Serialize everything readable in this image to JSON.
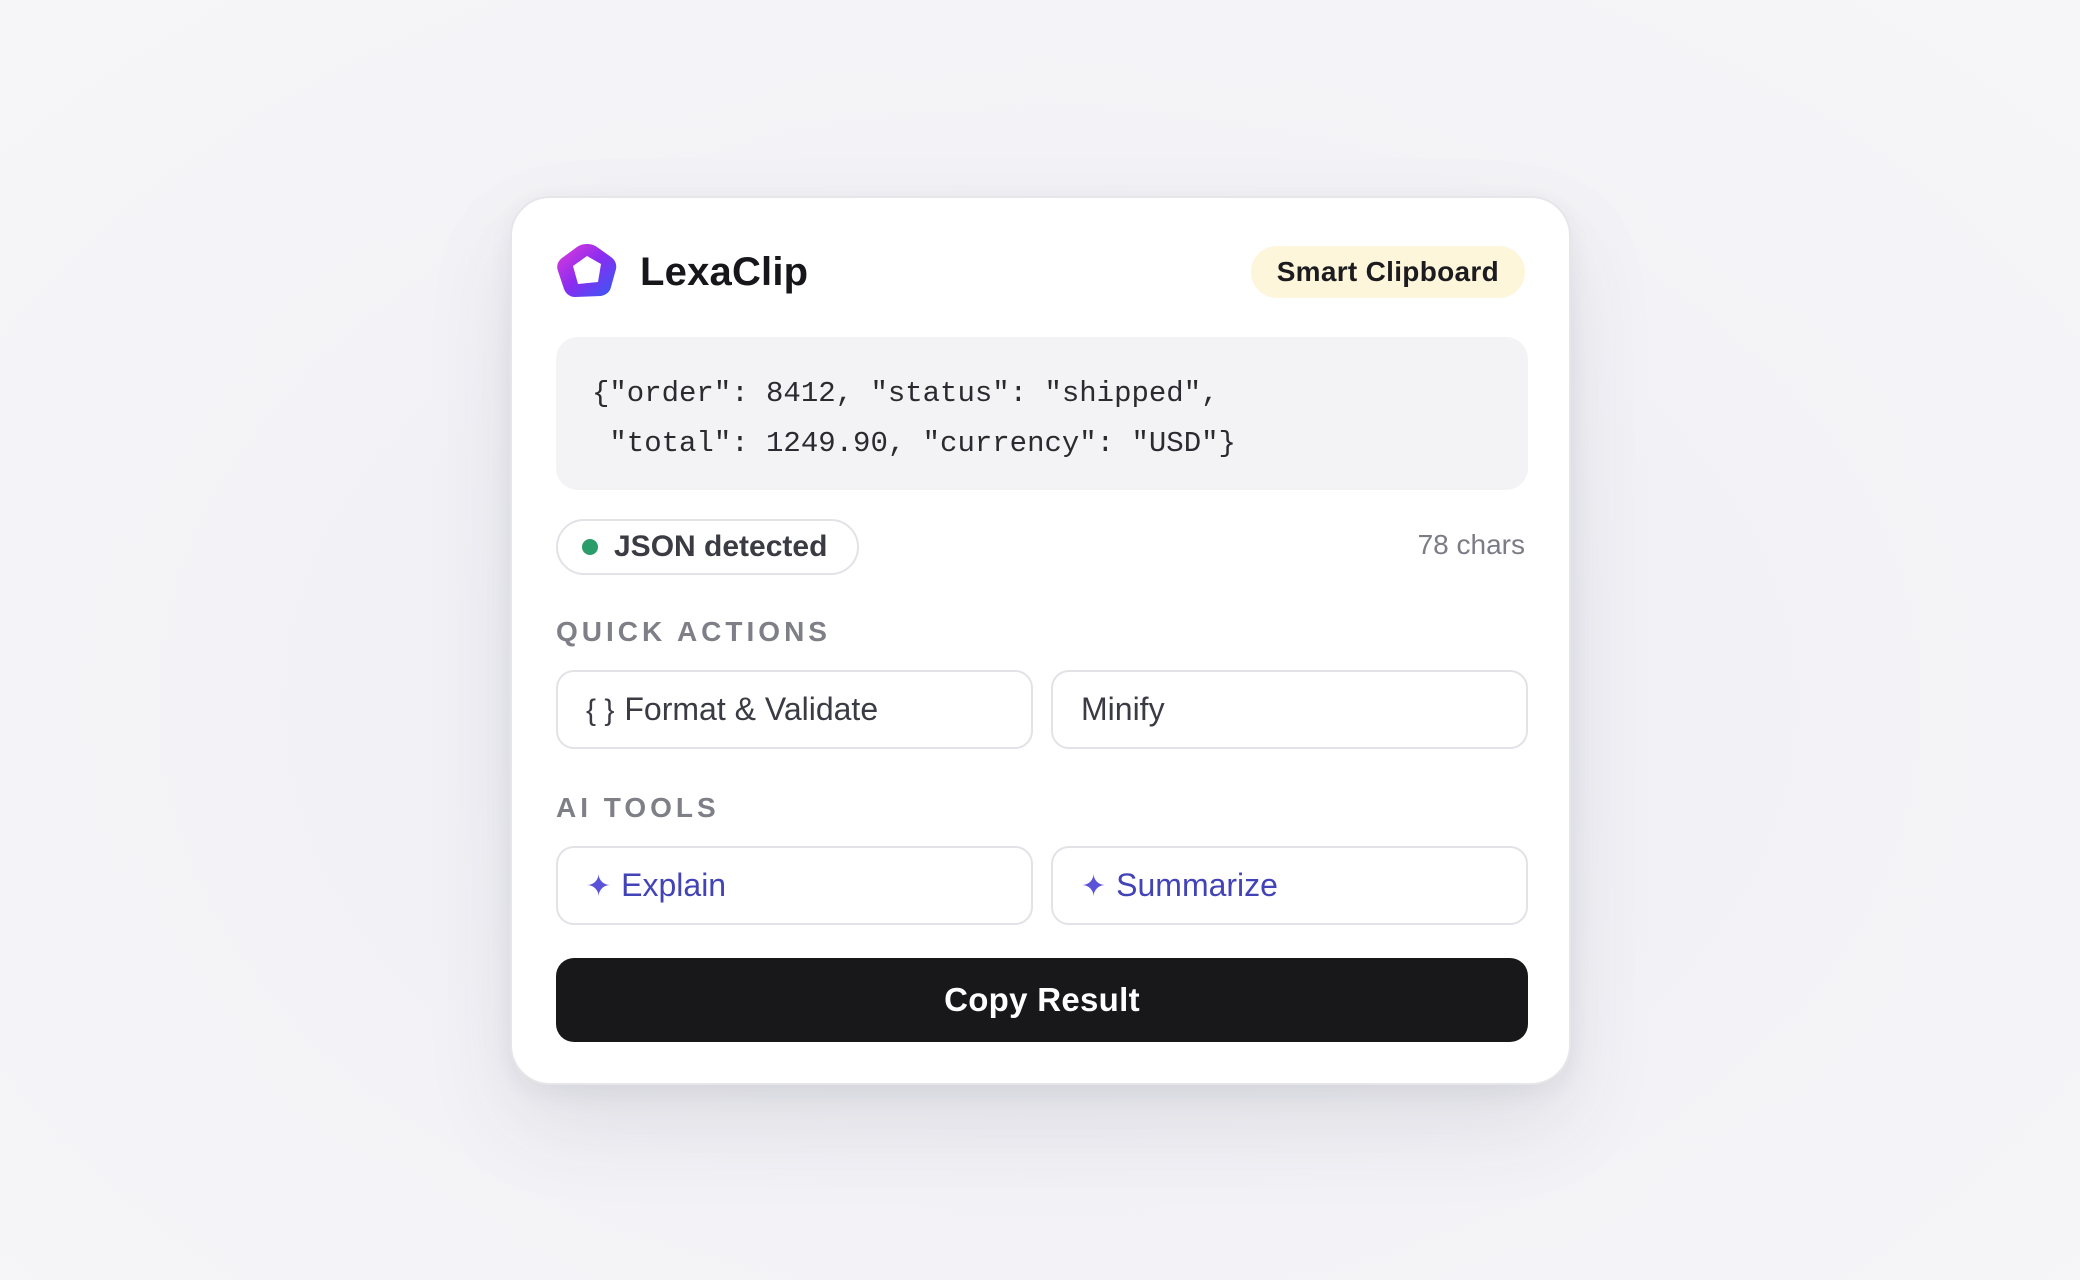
{
  "app": {
    "name": "LexaClip",
    "mode_badge": "Smart Clipboard"
  },
  "clipboard": {
    "content": "{\"order\": 8412, \"status\": \"shipped\",\n \"total\": 1249.90, \"currency\": \"USD\"}",
    "detected_type": "JSON detected",
    "char_count": "78 chars"
  },
  "quick_actions": {
    "label": "QUICK ACTIONS",
    "format": {
      "glyph": "{ }",
      "label": "Format & Validate"
    },
    "minify": {
      "label": "Minify"
    }
  },
  "ai_tools": {
    "label": "AI TOOLS",
    "explain": {
      "glyph": "✦",
      "label": "Explain"
    },
    "summarize": {
      "glyph": "✦",
      "label": "Summarize"
    }
  },
  "primary_action": {
    "label": "Copy Result"
  },
  "colors": {
    "accent": "#4343b8",
    "status_ok": "#2a9d6a",
    "badge_bg": "#fdf6da",
    "cta_bg": "#18181b"
  },
  "icons": {
    "logo": "lexaclip-logo-icon",
    "status": "status-dot-icon",
    "format": "braces-icon",
    "ai": "sparkle-icon"
  }
}
